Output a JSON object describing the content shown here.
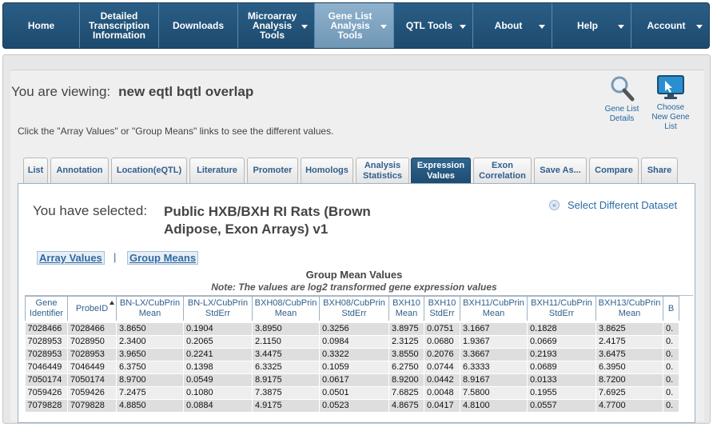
{
  "nav": [
    {
      "label": "Home",
      "caret": false
    },
    {
      "label": "Detailed\nTranscription\nInformation",
      "caret": false
    },
    {
      "label": "Downloads",
      "caret": false
    },
    {
      "label": "Microarray\nAnalysis\nTools",
      "caret": true
    },
    {
      "label": "Gene List\nAnalysis\nTools",
      "caret": true,
      "active": true
    },
    {
      "label": "QTL Tools",
      "caret": true
    },
    {
      "label": "About",
      "caret": true
    },
    {
      "label": "Help",
      "caret": true
    },
    {
      "label": "Account",
      "caret": true
    }
  ],
  "viewing": {
    "label": "You are viewing:",
    "name": "new eqtl bqtl overlap"
  },
  "hint": "Click the \"Array Values\" or \"Group Means\" links to see the different values.",
  "tools": {
    "details": "Gene List\nDetails",
    "choose": "Choose\nNew Gene\nList"
  },
  "tabs": [
    {
      "label": "List"
    },
    {
      "label": "Annotation"
    },
    {
      "label": "Location(eQTL)"
    },
    {
      "label": "Literature"
    },
    {
      "label": "Promoter"
    },
    {
      "label": "Homologs"
    },
    {
      "label": "Analysis\nStatistics"
    },
    {
      "label": "Expression\nValues",
      "active": true
    },
    {
      "label": "Exon\nCorrelation"
    },
    {
      "label": "Save As..."
    },
    {
      "label": "Compare"
    },
    {
      "label": "Share"
    }
  ],
  "selected": {
    "label": "You have selected:",
    "value": "Public HXB/BXH RI Rats (Brown Adipose, Exon Arrays) v1",
    "select_link": "Select Different Dataset",
    "select_icon": "«"
  },
  "links": {
    "array_values": "Array Values",
    "separator": "|",
    "group_means": "Group Means"
  },
  "table": {
    "title": "Group Mean Values",
    "note": "Note: The values are log2 transformed gene expression values",
    "columns": [
      "Gene\nIdentifier",
      "ProbeID",
      "BN-LX/CubPrin\nMean",
      "BN-LX/CubPrin\nStdErr",
      "BXH08/CubPrin\nMean",
      "BXH08/CubPrin\nStdErr",
      "BXH10\nMean",
      "BXH10\nStdErr",
      "BXH11/CubPrin\nMean",
      "BXH11/CubPrin\nStdErr",
      "BXH13/CubPrin\nMean",
      "B"
    ],
    "rows": [
      [
        "7028466",
        "7028466",
        "3.8650",
        "0.1904",
        "3.8950",
        "0.3256",
        "3.8975",
        "0.0751",
        "3.1667",
        "0.1828",
        "3.8625",
        "0."
      ],
      [
        "7028953",
        "7028950",
        "2.3400",
        "0.2065",
        "2.1150",
        "0.0984",
        "2.3125",
        "0.0680",
        "1.9367",
        "0.0669",
        "2.4175",
        "0."
      ],
      [
        "7028953",
        "7028953",
        "3.9650",
        "0.2241",
        "3.4475",
        "0.3322",
        "3.8550",
        "0.2076",
        "3.3667",
        "0.2193",
        "3.6475",
        "0."
      ],
      [
        "7046449",
        "7046449",
        "6.3750",
        "0.1398",
        "6.3325",
        "0.1059",
        "6.2750",
        "0.0744",
        "6.3333",
        "0.0689",
        "6.3950",
        "0."
      ],
      [
        "7050174",
        "7050174",
        "8.9700",
        "0.0549",
        "8.9175",
        "0.0617",
        "8.9200",
        "0.0442",
        "8.9167",
        "0.0133",
        "8.7200",
        "0."
      ],
      [
        "7059426",
        "7059426",
        "7.2475",
        "0.1080",
        "7.3875",
        "0.0501",
        "7.6825",
        "0.0048",
        "7.5800",
        "0.1955",
        "7.6925",
        "0."
      ],
      [
        "7079828",
        "7079828",
        "4.8850",
        "0.0884",
        "4.9175",
        "0.0523",
        "4.8675",
        "0.0417",
        "4.8100",
        "0.0557",
        "4.7700",
        "0."
      ]
    ]
  }
}
